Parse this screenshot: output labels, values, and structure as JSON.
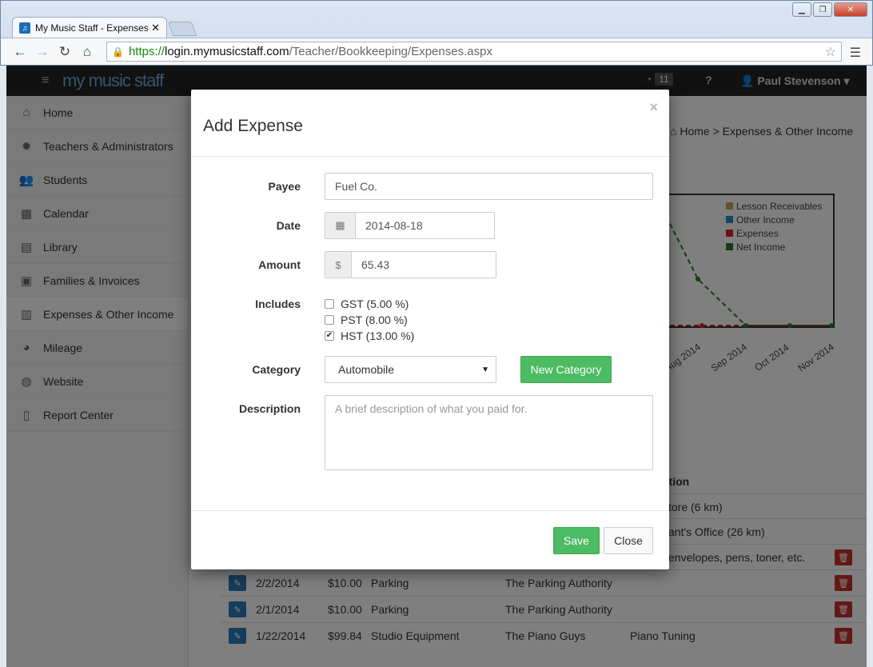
{
  "browser": {
    "tab_title": "My Music Staff - Expenses",
    "tab_close": "✕",
    "url_scheme": "https://",
    "url_host": "login.mymusicstaff.com",
    "url_path": "/Teacher/Bookkeeping/Expenses.aspx"
  },
  "app": {
    "logo": "my music staff",
    "rss_count": "11",
    "user_name": "Paul Stevenson",
    "breadcrumb": "Home > Expenses & Other Income"
  },
  "sidebar": {
    "items": [
      {
        "label": "Home",
        "icon": "home-icon"
      },
      {
        "label": "Teachers & Administrators",
        "icon": "gear-icon"
      },
      {
        "label": "Students",
        "icon": "users-icon"
      },
      {
        "label": "Calendar",
        "icon": "calendar-icon"
      },
      {
        "label": "Library",
        "icon": "book-icon"
      },
      {
        "label": "Families & Invoices",
        "icon": "money-icon"
      },
      {
        "label": "Expenses & Other Income",
        "icon": "bar-chart-icon"
      },
      {
        "label": "Mileage",
        "icon": "dashboard-icon"
      },
      {
        "label": "Website",
        "icon": "globe-icon"
      },
      {
        "label": "Report Center",
        "icon": "file-icon"
      }
    ]
  },
  "chart": {
    "legend": [
      "Lesson Receivables",
      "Other Income",
      "Expenses",
      "Net Income"
    ],
    "legend_colors": [
      "#c9a35a",
      "#2a8ac8",
      "#d22",
      "#2a7a2a"
    ],
    "ticks": [
      "Aug 2014",
      "Sep 2014",
      "Oct 2014",
      "Nov 2014"
    ]
  },
  "table": {
    "desc_header": "ption",
    "partial_rows": [
      {
        "desc": "tore (6 km)"
      },
      {
        "desc": "ant's Office (26 km)"
      },
      {
        "desc": "envelopes, pens, toner, etc."
      }
    ],
    "rows": [
      {
        "date": "2/2/2014",
        "amount": "$10.00",
        "category": "Parking",
        "payee": "The Parking Authority",
        "desc": ""
      },
      {
        "date": "2/1/2014",
        "amount": "$10.00",
        "category": "Parking",
        "payee": "The Parking Authority",
        "desc": ""
      },
      {
        "date": "1/22/2014",
        "amount": "$99.84",
        "category": "Studio Equipment",
        "payee": "The Piano Guys",
        "desc": "Piano Tuning"
      }
    ]
  },
  "modal": {
    "title": "Add Expense",
    "close": "×",
    "payee_label": "Payee",
    "payee_value": "Fuel Co.",
    "date_label": "Date",
    "date_value": "2014-08-18",
    "amount_label": "Amount",
    "amount_prefix": "$",
    "amount_value": "65.43",
    "includes_label": "Includes",
    "taxes": [
      {
        "label": "GST (5.00 %)",
        "checked": false
      },
      {
        "label": "PST (8.00 %)",
        "checked": false
      },
      {
        "label": "HST (13.00 %)",
        "checked": true
      }
    ],
    "category_label": "Category",
    "category_value": "Automobile",
    "new_category_label": "New Category",
    "description_label": "Description",
    "description_placeholder": "A brief description of what you paid for.",
    "save_label": "Save",
    "close_label": "Close"
  }
}
